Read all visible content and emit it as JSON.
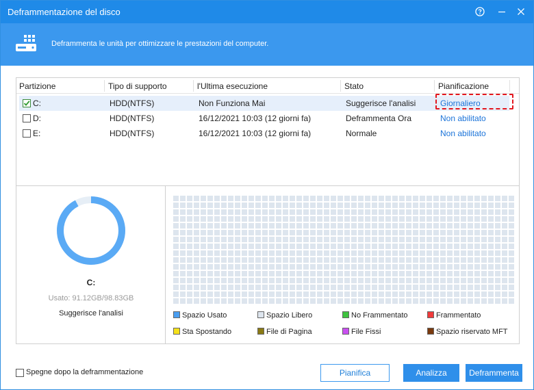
{
  "window": {
    "title": "Deframmentazione del disco",
    "help_glyph": "?",
    "minimize_glyph": "—",
    "close_glyph": "✕"
  },
  "banner": {
    "subtitle": "Deframmenta le unità per ottimizzare le prestazioni del computer.",
    "icon": "disk-drive-icon"
  },
  "table": {
    "columns": [
      "Partizione",
      "Tipo di supporto",
      "l'Ultima esecuzione",
      "Stato",
      "Pianificazione"
    ],
    "rows": [
      {
        "partition": "C:",
        "checked": true,
        "media": "HDD(NTFS)",
        "last_run": "Non Funziona Mai",
        "status": "Suggerisce l'analisi",
        "schedule": "Giornaliero",
        "selected": true
      },
      {
        "partition": "D:",
        "checked": false,
        "media": "HDD(NTFS)",
        "last_run": "16/12/2021 10:03 (12 giorni fa)",
        "status": "Deframmenta Ora",
        "schedule": "Non abilitato",
        "selected": false
      },
      {
        "partition": "E:",
        "checked": false,
        "media": "HDD(NTFS)",
        "last_run": "16/12/2021 10:03 (12 giorni fa)",
        "status": "Normale",
        "schedule": "Non abilitato",
        "selected": false
      }
    ]
  },
  "drive_info": {
    "label": "C:",
    "usage": "Usato: 91.12GB/98.83GB",
    "used_gb": 91.12,
    "total_gb": 98.83,
    "status": "Suggerisce l'analisi",
    "used_color": "#5aaaf5",
    "free_color": "#e6eef6"
  },
  "legend": [
    {
      "label": "Spazio Usato",
      "color": "#4a9ef0"
    },
    {
      "label": "Spazio Libero",
      "color": "#dde5ee"
    },
    {
      "label": "No Frammentato",
      "color": "#3fc33f"
    },
    {
      "label": "Frammentato",
      "color": "#f03a3a"
    },
    {
      "label": "Sta Spostando",
      "color": "#f5e11a"
    },
    {
      "label": "File di Pagina",
      "color": "#8a7a14"
    },
    {
      "label": "File Fissi",
      "color": "#c94ff0"
    },
    {
      "label": "Spazio riservato MFT",
      "color": "#7a3a0e"
    }
  ],
  "footer": {
    "shutdown_label": "Spegne dopo la deframmentazione",
    "shutdown_checked": false,
    "schedule_button": "Pianifica",
    "analyze_button": "Analizza",
    "defrag_button": "Deframmenta"
  },
  "colors": {
    "titlebar": "#1f8ae8",
    "banner": "#3b98ee",
    "accent": "#2f8fea",
    "highlight_dashed": "#e3161d"
  }
}
